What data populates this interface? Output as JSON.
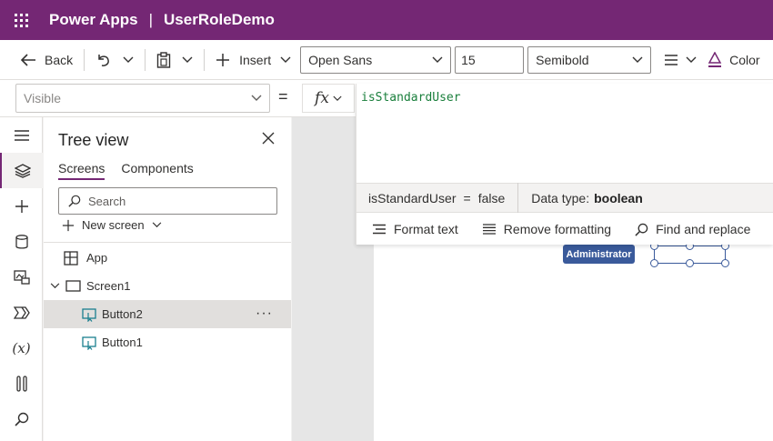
{
  "titlebar": {
    "app_name": "Power Apps",
    "separator": "|",
    "doc_name": "UserRoleDemo",
    "bg_color": "#742774"
  },
  "cmdbar": {
    "back_label": "Back",
    "insert_label": "Insert",
    "font_family_value": "Open Sans",
    "font_size_value": "15",
    "font_weight_value": "Semibold",
    "color_label": "Color"
  },
  "formula": {
    "property_value": "Visible",
    "equals": "=",
    "fx_label": "fx",
    "expression": "isStandardUser",
    "result_name": "isStandardUser",
    "result_eq": "=",
    "result_value": "false",
    "data_type_label": "Data type:",
    "data_type_value": "boolean",
    "format_text": "Format text",
    "remove_formatting": "Remove formatting",
    "find_replace": "Find and replace"
  },
  "rail": {
    "icons": [
      "hamburger-icon",
      "layers-icon",
      "plus-icon",
      "database-icon",
      "media-icon",
      "power-automate-icon",
      "variables-icon",
      "tools-icon",
      "search-icon"
    ]
  },
  "tree": {
    "title": "Tree view",
    "tabs": [
      {
        "label": "Screens",
        "active": true
      },
      {
        "label": "Components",
        "active": false
      }
    ],
    "search_placeholder": "Search",
    "new_screen_label": "New screen",
    "nodes": [
      {
        "label": "App",
        "icon": "app-icon"
      },
      {
        "label": "Screen1",
        "icon": "screen-icon"
      },
      {
        "label": "Button2",
        "icon": "button-icon",
        "selected": true
      },
      {
        "label": "Button1",
        "icon": "button-icon"
      }
    ],
    "more_label": "···"
  },
  "canvas": {
    "admin_button_label": "Administrator",
    "admin_button_color": "#3a5a9b"
  }
}
